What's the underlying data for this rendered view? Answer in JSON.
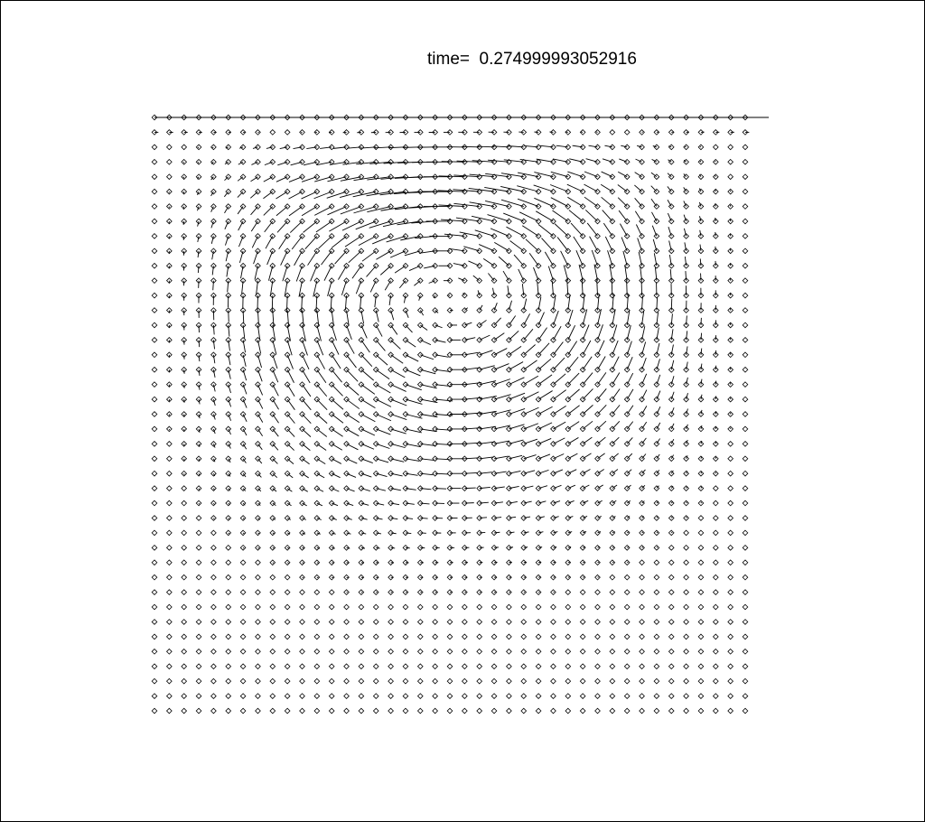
{
  "title": "time=  0.274999993052916",
  "chart_data": {
    "type": "quiver",
    "title": "time=  0.274999993052916",
    "time_label": "time=",
    "time_value": "0.274999993052916",
    "grid": {
      "nx": 41,
      "ny": 41
    },
    "domain": {
      "x": [
        0,
        1
      ],
      "y": [
        0,
        1
      ]
    },
    "marker": "diamond",
    "description_of_field": "lid-driven cavity velocity field; primary vortex centred near (0.55, 0.75), strongest flow along the top lid moving right",
    "vortex_center": [
      0.55,
      0.75
    ],
    "lid_velocity": 1.0,
    "axes_visible": false,
    "grid_lines": false,
    "colors": {
      "vectors": "#000000",
      "background": "#ffffff"
    }
  }
}
